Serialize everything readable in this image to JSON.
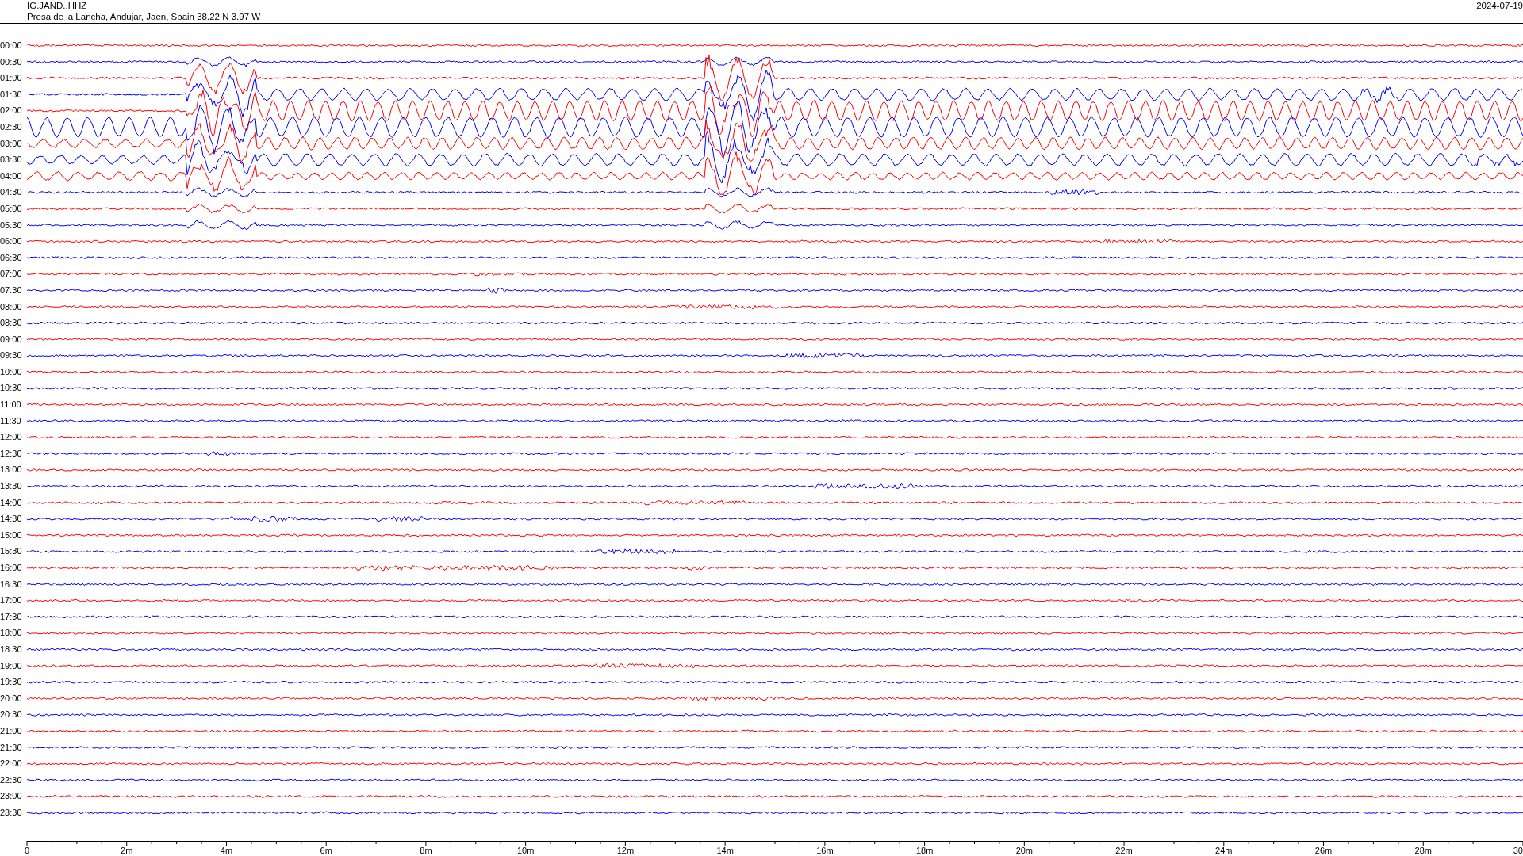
{
  "header": {
    "station": "IG.JAND..HHZ",
    "location": "Presa de la Lancha, Andujar, Jaen, Spain  38.22 N 3.97 W",
    "date": "2024-07-19"
  },
  "rows": [
    {
      "time": "00:00",
      "color": "#ff0000"
    },
    {
      "time": "00:30",
      "color": "#0000ff"
    },
    {
      "time": "01:00",
      "color": "#ff0000"
    },
    {
      "time": "01:30",
      "color": "#0000ff"
    },
    {
      "time": "02:00",
      "color": "#ff0000"
    },
    {
      "time": "02:30",
      "color": "#0000ff"
    },
    {
      "time": "03:00",
      "color": "#ff0000"
    },
    {
      "time": "03:30",
      "color": "#0000ff"
    },
    {
      "time": "04:00",
      "color": "#ff0000"
    },
    {
      "time": "04:30",
      "color": "#0000ff"
    },
    {
      "time": "05:00",
      "color": "#ff0000"
    },
    {
      "time": "05:30",
      "color": "#0000ff"
    },
    {
      "time": "06:00",
      "color": "#ff0000"
    },
    {
      "time": "06:30",
      "color": "#0000ff"
    },
    {
      "time": "07:00",
      "color": "#ff0000"
    },
    {
      "time": "07:30",
      "color": "#0000ff"
    },
    {
      "time": "08:00",
      "color": "#ff0000"
    },
    {
      "time": "08:30",
      "color": "#0000ff"
    },
    {
      "time": "09:00",
      "color": "#ff0000"
    },
    {
      "time": "09:30",
      "color": "#0000ff"
    },
    {
      "time": "10:00",
      "color": "#ff0000"
    },
    {
      "time": "10:30",
      "color": "#0000ff"
    },
    {
      "time": "11:00",
      "color": "#ff0000"
    },
    {
      "time": "11:30",
      "color": "#0000ff"
    },
    {
      "time": "12:00",
      "color": "#ff0000"
    },
    {
      "time": "12:30",
      "color": "#0000ff"
    },
    {
      "time": "13:00",
      "color": "#ff0000"
    },
    {
      "time": "13:30",
      "color": "#0000ff"
    },
    {
      "time": "14:00",
      "color": "#ff0000"
    },
    {
      "time": "14:30",
      "color": "#0000ff"
    },
    {
      "time": "15:00",
      "color": "#ff0000"
    },
    {
      "time": "15:30",
      "color": "#0000ff"
    },
    {
      "time": "16:00",
      "color": "#ff0000"
    },
    {
      "time": "16:30",
      "color": "#0000ff"
    },
    {
      "time": "17:00",
      "color": "#ff0000"
    },
    {
      "time": "17:30",
      "color": "#0000ff"
    },
    {
      "time": "18:00",
      "color": "#ff0000"
    },
    {
      "time": "18:30",
      "color": "#0000ff"
    },
    {
      "time": "19:00",
      "color": "#ff0000"
    },
    {
      "time": "19:30",
      "color": "#0000ff"
    },
    {
      "time": "20:00",
      "color": "#ff0000"
    },
    {
      "time": "20:30",
      "color": "#0000ff"
    },
    {
      "time": "21:00",
      "color": "#ff0000"
    },
    {
      "time": "21:30",
      "color": "#0000ff"
    },
    {
      "time": "22:00",
      "color": "#ff0000"
    },
    {
      "time": "22:30",
      "color": "#0000ff"
    },
    {
      "time": "23:00",
      "color": "#ff0000"
    },
    {
      "time": "23:30",
      "color": "#0000ff"
    }
  ],
  "x_axis": {
    "ticks": [
      "0",
      "2m",
      "4m",
      "6m",
      "8m",
      "10m",
      "12m",
      "14m",
      "16m",
      "18m",
      "20m",
      "22m",
      "24m",
      "26m",
      "28m",
      "30"
    ]
  }
}
